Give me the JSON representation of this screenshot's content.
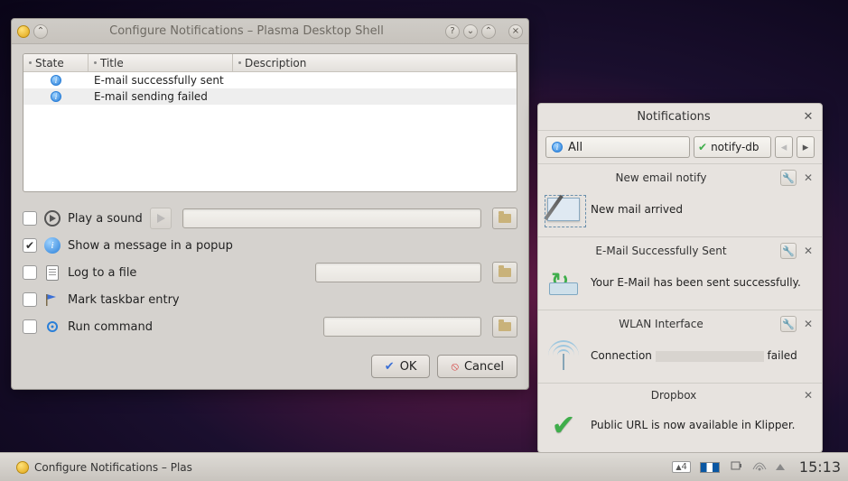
{
  "config_window": {
    "title": "Configure Notifications – Plasma Desktop Shell",
    "columns": {
      "state": "State",
      "title": "Title",
      "description": "Description"
    },
    "rows": [
      {
        "title": "E-mail successfully sent"
      },
      {
        "title": "E-mail sending failed"
      }
    ],
    "options": {
      "sound": {
        "label": "Play a sound",
        "checked": false
      },
      "popup": {
        "label": "Show a message in a popup",
        "checked": true
      },
      "log": {
        "label": "Log to a file",
        "checked": false
      },
      "taskbar": {
        "label": "Mark taskbar entry",
        "checked": false
      },
      "command": {
        "label": "Run command",
        "checked": false
      }
    },
    "buttons": {
      "ok": "OK",
      "cancel": "Cancel"
    }
  },
  "notifications_panel": {
    "title": "Notifications",
    "filter_all": "All",
    "filter_app": "notify-db",
    "items": [
      {
        "title": "New email notify",
        "body": "New mail arrived",
        "tool": true
      },
      {
        "title": "E-Mail Successfully Sent",
        "body": "Your E-Mail has been sent successfully.",
        "tool": true
      },
      {
        "title": "WLAN Interface",
        "body_pre": "Connection ",
        "body_post": " failed",
        "tool": true
      },
      {
        "title": "Dropbox",
        "body": "Public URL is now available in Klipper.",
        "tool": false
      }
    ]
  },
  "taskbar": {
    "task_label": "Configure Notifications – Plas",
    "updates": "4",
    "clock": "15:13"
  }
}
